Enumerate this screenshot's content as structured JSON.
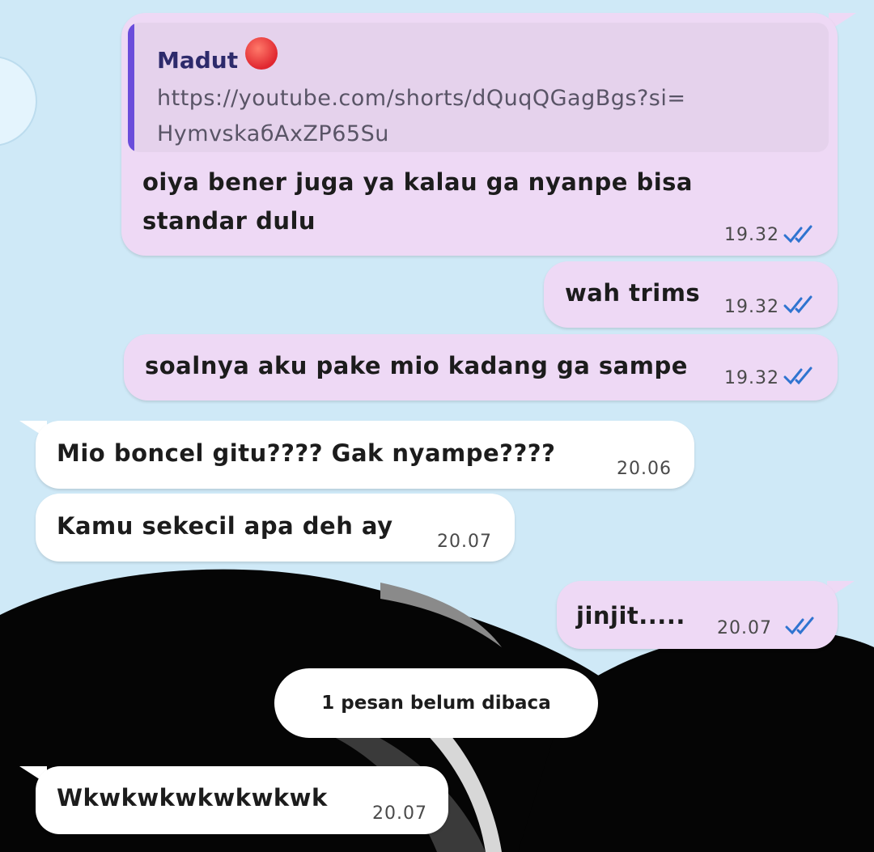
{
  "colors": {
    "wallpaper": "#cfe9f7",
    "outgoing_bubble": "#eed9f5",
    "incoming_bubble": "#ffffff",
    "quote_bar": "#6a4ddb",
    "read_ticks": "#2f74d0"
  },
  "quoted": {
    "author": "Madut",
    "author_emoji": "angry-face-icon",
    "link_line1": "https://youtube.com/shorts/dQuqQGagBgs?si=",
    "link_line2": "HymvskaбAxZP65Su"
  },
  "messages": [
    {
      "direction": "out",
      "lines": [
        "oiya bener juga ya kalau ga nyanpe bisa",
        "standar dulu"
      ],
      "time": "19.32",
      "status": "read"
    },
    {
      "direction": "out",
      "text": "wah trims",
      "time": "19.32",
      "status": "read"
    },
    {
      "direction": "out",
      "text": "soalnya aku pake mio kadang ga sampe",
      "time": "19.32",
      "status": "read"
    },
    {
      "direction": "in",
      "text": "Mio boncel gitu???? Gak nyampe????",
      "time": "20.06"
    },
    {
      "direction": "in",
      "text": "Kamu sekecil apa deh ay",
      "time": "20.07"
    },
    {
      "direction": "out",
      "text": "jinjit.....",
      "time": "20.07",
      "status": "read"
    },
    {
      "direction": "in",
      "text": "Wkwkwkwkwkwkwk",
      "time": "20.07"
    }
  ],
  "unread_banner": "1 pesan belum dibaca"
}
